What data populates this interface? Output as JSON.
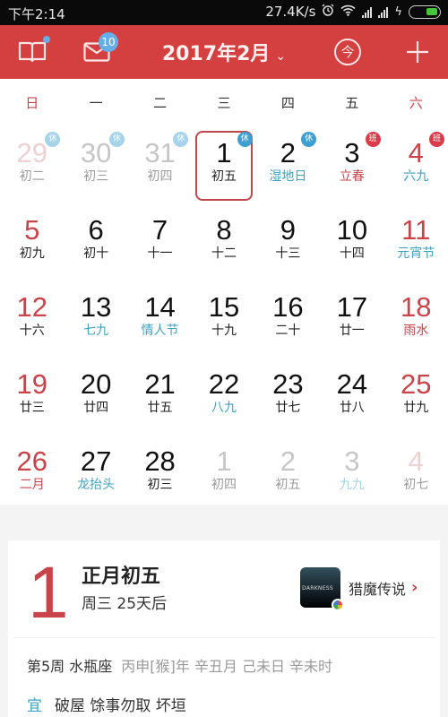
{
  "status_bar": {
    "time": "下午2:14",
    "net_speed": "27.4K/s",
    "icons": [
      "alarm-icon",
      "wifi-icon",
      "signal-icon",
      "signal-icon",
      "charging-icon",
      "battery-icon"
    ],
    "battery_color": "#46c43c"
  },
  "header": {
    "title": "2017年2月",
    "title_dropdown_icon": "chevron-down-icon",
    "left_icons": [
      "book-icon",
      "mail-icon"
    ],
    "mail_badge": "10",
    "today_button": "今",
    "add_button": "+",
    "accent_color": "#d43f3f"
  },
  "weekdays": [
    "日",
    "一",
    "二",
    "三",
    "四",
    "五",
    "六"
  ],
  "tags": {
    "rest": "休",
    "work": "班"
  },
  "weeks": [
    [
      {
        "day": "29",
        "sub": "初二",
        "other": true,
        "red": true,
        "tag": "rest"
      },
      {
        "day": "30",
        "sub": "初三",
        "other": true,
        "tag": "rest"
      },
      {
        "day": "31",
        "sub": "初四",
        "other": true,
        "tag": "rest"
      },
      {
        "day": "1",
        "sub": "初五",
        "today": true,
        "tag": "rest"
      },
      {
        "day": "2",
        "sub": "湿地日",
        "subColor": "blue",
        "tag": "rest"
      },
      {
        "day": "3",
        "sub": "立春",
        "subColor": "red",
        "tag": "work"
      },
      {
        "day": "4",
        "sub": "六九",
        "subColor": "blue",
        "red": true,
        "tag": "work"
      }
    ],
    [
      {
        "day": "5",
        "sub": "初九",
        "red": true
      },
      {
        "day": "6",
        "sub": "初十"
      },
      {
        "day": "7",
        "sub": "十一"
      },
      {
        "day": "8",
        "sub": "十二"
      },
      {
        "day": "9",
        "sub": "十三"
      },
      {
        "day": "10",
        "sub": "十四"
      },
      {
        "day": "11",
        "sub": "元宵节",
        "subColor": "blue",
        "red": true
      }
    ],
    [
      {
        "day": "12",
        "sub": "十六",
        "red": true
      },
      {
        "day": "13",
        "sub": "七九",
        "subColor": "blue"
      },
      {
        "day": "14",
        "sub": "情人节",
        "subColor": "blue"
      },
      {
        "day": "15",
        "sub": "十九"
      },
      {
        "day": "16",
        "sub": "二十"
      },
      {
        "day": "17",
        "sub": "廿一"
      },
      {
        "day": "18",
        "sub": "雨水",
        "subColor": "red",
        "red": true
      }
    ],
    [
      {
        "day": "19",
        "sub": "廿三",
        "red": true
      },
      {
        "day": "20",
        "sub": "廿四"
      },
      {
        "day": "21",
        "sub": "廿五"
      },
      {
        "day": "22",
        "sub": "八九",
        "subColor": "blue"
      },
      {
        "day": "23",
        "sub": "廿七"
      },
      {
        "day": "24",
        "sub": "廿八"
      },
      {
        "day": "25",
        "sub": "廿九",
        "red": true
      }
    ],
    [
      {
        "day": "26",
        "sub": "二月",
        "subColor": "red",
        "red": true
      },
      {
        "day": "27",
        "sub": "龙抬头",
        "subColor": "blue"
      },
      {
        "day": "28",
        "sub": "初三"
      },
      {
        "day": "1",
        "sub": "初四",
        "other": true
      },
      {
        "day": "2",
        "sub": "初五",
        "other": true
      },
      {
        "day": "3",
        "sub": "九九",
        "subColor": "blue",
        "other": true
      },
      {
        "day": "4",
        "sub": "初七",
        "other": true,
        "red": true
      }
    ]
  ],
  "detail": {
    "day": "1",
    "lunar_date": "正月初五",
    "weekday_and_countdown": "周三 25天后",
    "ad_label": "猎魔传说",
    "ad_image_text": "DARKNESS",
    "week_info": "第5周 水瓶座",
    "ganzhi": "丙申[猴]年 辛丑月 己未日 辛未时",
    "yi_label": "宜",
    "yi_items": "破屋 馀事勿取 坏垣"
  }
}
